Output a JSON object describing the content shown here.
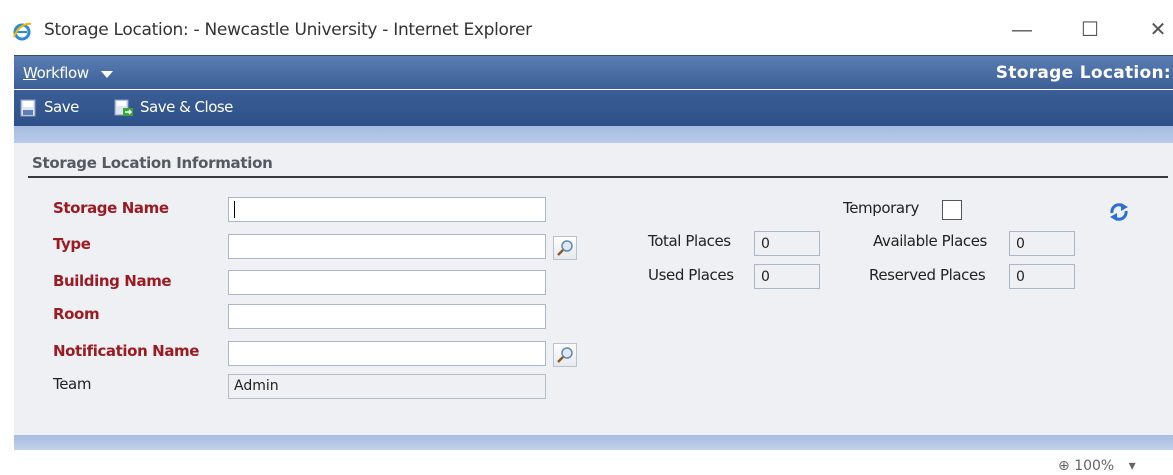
{
  "window": {
    "title": "Storage Location: - Newcastle University - Internet Explorer",
    "minimize_glyph": "—",
    "maximize_glyph": "☐",
    "close_glyph": "✕"
  },
  "menu": {
    "workflow_label_first": "W",
    "workflow_label_rest": "orkflow",
    "page_header": "Storage Location:"
  },
  "toolbar": {
    "save_label": "Save",
    "save_close_label": "Save & Close"
  },
  "section": {
    "title": "Storage Location Information"
  },
  "fields": {
    "storage_name": {
      "label": "Storage Name",
      "value": ""
    },
    "type": {
      "label": "Type",
      "value": ""
    },
    "building_name": {
      "label": "Building Name",
      "value": ""
    },
    "room": {
      "label": "Room",
      "value": ""
    },
    "notification_name": {
      "label": "Notification Name",
      "value": ""
    },
    "team": {
      "label": "Team",
      "value": "Admin"
    },
    "temporary": {
      "label": "Temporary",
      "checked": false
    },
    "total_places": {
      "label": "Total Places",
      "value": "0"
    },
    "used_places": {
      "label": "Used Places",
      "value": "0"
    },
    "available_places": {
      "label": "Available Places",
      "value": "0"
    },
    "reserved_places": {
      "label": "Reserved Places",
      "value": "0"
    }
  },
  "status": {
    "zoom": "100%"
  },
  "colors": {
    "required_label": "#9b1b25",
    "menubar": "#3c5f97",
    "strip": "#b9cbea"
  },
  "icons": [
    "ie-icon",
    "caret-down-icon",
    "save-icon",
    "save-close-icon",
    "lookup-icon",
    "refresh-icon",
    "zoom-icon"
  ]
}
